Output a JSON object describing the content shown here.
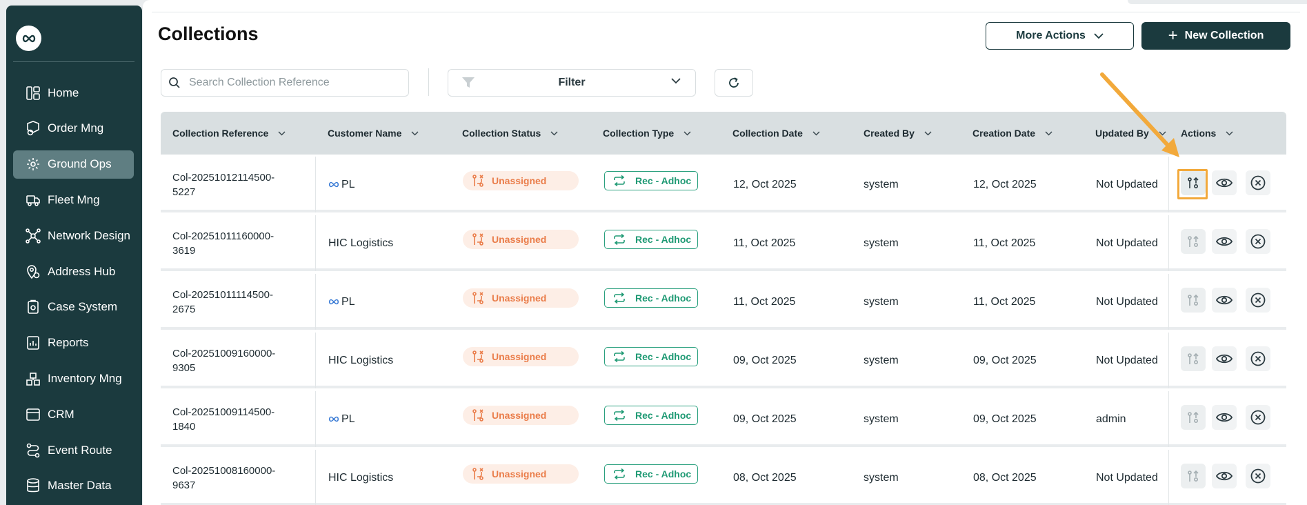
{
  "sidebar": {
    "items": [
      {
        "label": "Home",
        "icon": "home-icon",
        "active": false
      },
      {
        "label": "Order Mng",
        "icon": "order-icon",
        "active": false
      },
      {
        "label": "Ground Ops",
        "icon": "ground-ops-icon",
        "active": true
      },
      {
        "label": "Fleet Mng",
        "icon": "truck-icon",
        "active": false
      },
      {
        "label": "Network Design",
        "icon": "network-icon",
        "active": false
      },
      {
        "label": "Address Hub",
        "icon": "location-icon",
        "active": false
      },
      {
        "label": "Case System",
        "icon": "case-icon",
        "active": false
      },
      {
        "label": "Reports",
        "icon": "reports-icon",
        "active": false
      },
      {
        "label": "Inventory Mng",
        "icon": "inventory-icon",
        "active": false
      },
      {
        "label": "CRM",
        "icon": "crm-icon",
        "active": false
      },
      {
        "label": "Event Route",
        "icon": "route-icon",
        "active": false
      },
      {
        "label": "Master Data",
        "icon": "database-icon",
        "active": false
      }
    ]
  },
  "header": {
    "title": "Collections",
    "more_actions_label": "More Actions",
    "new_collection_label": "New Collection"
  },
  "toolbar": {
    "search_placeholder": "Search Collection Reference",
    "filter_label": "Filter"
  },
  "table": {
    "columns": [
      "Collection Reference",
      "Customer Name",
      "Collection Status",
      "Collection Type",
      "Collection Date",
      "Created By",
      "Creation Date",
      "Updated By",
      "Actions"
    ],
    "rows": [
      {
        "ref1": "Col-20251012114500-",
        "ref2": "5227",
        "customer": "PL",
        "customer_logo": true,
        "status": "Unassigned",
        "type": "Rec - Adhoc",
        "collection_date": "12, Oct 2025",
        "created_by": "system",
        "creation_date": "12, Oct 2025",
        "updated_by": "Not Updated"
      },
      {
        "ref1": "Col-20251011160000-",
        "ref2": "3619",
        "customer": "HIC Logistics",
        "customer_logo": false,
        "status": "Unassigned",
        "type": "Rec - Adhoc",
        "collection_date": "11, Oct 2025",
        "created_by": "system",
        "creation_date": "11, Oct 2025",
        "updated_by": "Not Updated"
      },
      {
        "ref1": "Col-20251011114500-",
        "ref2": "2675",
        "customer": "PL",
        "customer_logo": true,
        "status": "Unassigned",
        "type": "Rec - Adhoc",
        "collection_date": "11, Oct 2025",
        "created_by": "system",
        "creation_date": "11, Oct 2025",
        "updated_by": "Not Updated"
      },
      {
        "ref1": "Col-20251009160000-",
        "ref2": "9305",
        "customer": "HIC Logistics",
        "customer_logo": false,
        "status": "Unassigned",
        "type": "Rec - Adhoc",
        "collection_date": "09, Oct 2025",
        "created_by": "system",
        "creation_date": "09, Oct 2025",
        "updated_by": "Not Updated"
      },
      {
        "ref1": "Col-20251009114500-",
        "ref2": "1840",
        "customer": "PL",
        "customer_logo": true,
        "status": "Unassigned",
        "type": "Rec - Adhoc",
        "collection_date": "09, Oct 2025",
        "created_by": "system",
        "creation_date": "09, Oct 2025",
        "updated_by": "admin"
      },
      {
        "ref1": "Col-20251008160000-",
        "ref2": "9637",
        "customer": "HIC Logistics",
        "customer_logo": false,
        "status": "Unassigned",
        "type": "Rec - Adhoc",
        "collection_date": "08, Oct 2025",
        "created_by": "system",
        "creation_date": "08, Oct 2025",
        "updated_by": "Not Updated"
      }
    ]
  },
  "colors": {
    "sidebar_bg": "#1b3a3e",
    "active_nav": "#5f7e82",
    "status_text": "#ea7d4a",
    "status_bg": "#fdeee6",
    "type_green": "#1f9a74",
    "highlight": "#f2a93b"
  }
}
